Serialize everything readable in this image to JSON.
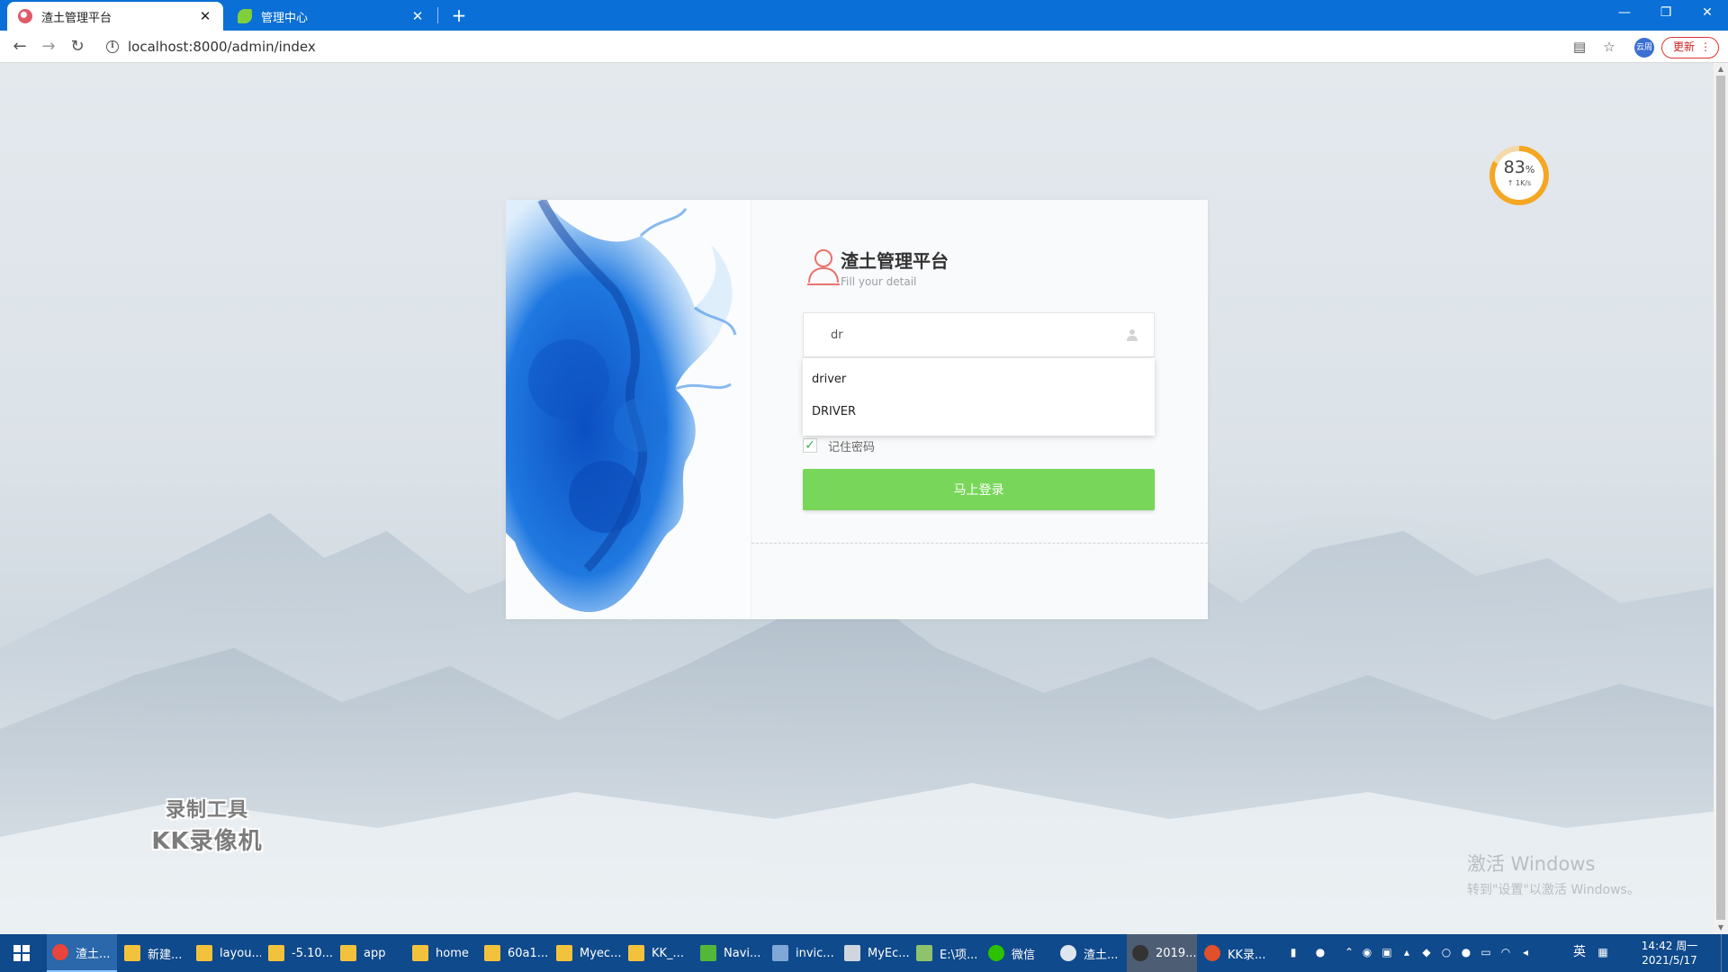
{
  "browser": {
    "tabs": [
      {
        "title": "渣土管理平台",
        "active": true
      },
      {
        "title": "管理中心",
        "active": false
      }
    ],
    "close_glyph": "✕",
    "new_tab_glyph": "+",
    "url": "localhost:8000/admin/index",
    "profile_label": "云周",
    "update_label": "更新",
    "update_menu_glyph": "⋮",
    "icons": [
      "back-icon",
      "forward-icon",
      "reload-icon",
      "info-icon",
      "translate-icon",
      "star-icon",
      "minimize-icon",
      "restore-icon",
      "close-icon"
    ]
  },
  "speed_widget": {
    "percent": "83",
    "percent_sign": "%",
    "rate": "↑ 1K/s",
    "fill_fraction": 0.83,
    "color": "#f5a623"
  },
  "login": {
    "title": "渣土管理平台",
    "subtitle": "Fill your detail",
    "username_value": "dr",
    "autocomplete": [
      "driver",
      "DRIVER"
    ],
    "remember_label": "记住密码",
    "remember_checked": true,
    "submit_label": "马上登录",
    "accent_color": "#78d75a",
    "logo_color": "#e8736f"
  },
  "watermark": {
    "line1": "录制工具",
    "line2": "KK录像机"
  },
  "activation": {
    "title": "激活 Windows",
    "subtitle": "转到\"设置\"以激活 Windows。"
  },
  "taskbar": {
    "apps": [
      {
        "label": "渣土...",
        "icon": "chrome-icon",
        "color": "#e8453c"
      },
      {
        "label": "新建...",
        "icon": "folder-icon",
        "color": "#f3c23c"
      },
      {
        "label": "layou...",
        "icon": "folder-icon",
        "color": "#f3c23c"
      },
      {
        "label": "-5.10...",
        "icon": "folder-icon",
        "color": "#f3c23c"
      },
      {
        "label": "app",
        "icon": "folder-icon",
        "color": "#f3c23c"
      },
      {
        "label": "home",
        "icon": "folder-icon",
        "color": "#f3c23c"
      },
      {
        "label": "60a1...",
        "icon": "folder-icon",
        "color": "#f3c23c"
      },
      {
        "label": "Myec...",
        "icon": "folder-icon",
        "color": "#f3c23c"
      },
      {
        "label": "KK_...",
        "icon": "folder-icon",
        "color": "#f3c23c"
      },
      {
        "label": "Navi...",
        "icon": "navicat-icon",
        "color": "#53b83a"
      },
      {
        "label": "invic...",
        "icon": "window-icon",
        "color": "#7fa8d8"
      },
      {
        "label": "MyEc...",
        "icon": "eclipse-icon",
        "color": "#d0d6e0"
      },
      {
        "label": "E:\\项...",
        "icon": "notepad-icon",
        "color": "#8fc36b"
      },
      {
        "label": "微信",
        "icon": "wechat-icon",
        "color": "#2dc100"
      },
      {
        "label": "渣土...",
        "icon": "chat-icon",
        "color": "#e0e6ef"
      },
      {
        "label": "2019...",
        "icon": "recorder-icon",
        "color": "#333333"
      },
      {
        "label": "KK录...",
        "icon": "kk-icon",
        "color": "#e0502a"
      }
    ],
    "ime": "英",
    "time": "14:42 周一",
    "date": "2021/5/17"
  }
}
